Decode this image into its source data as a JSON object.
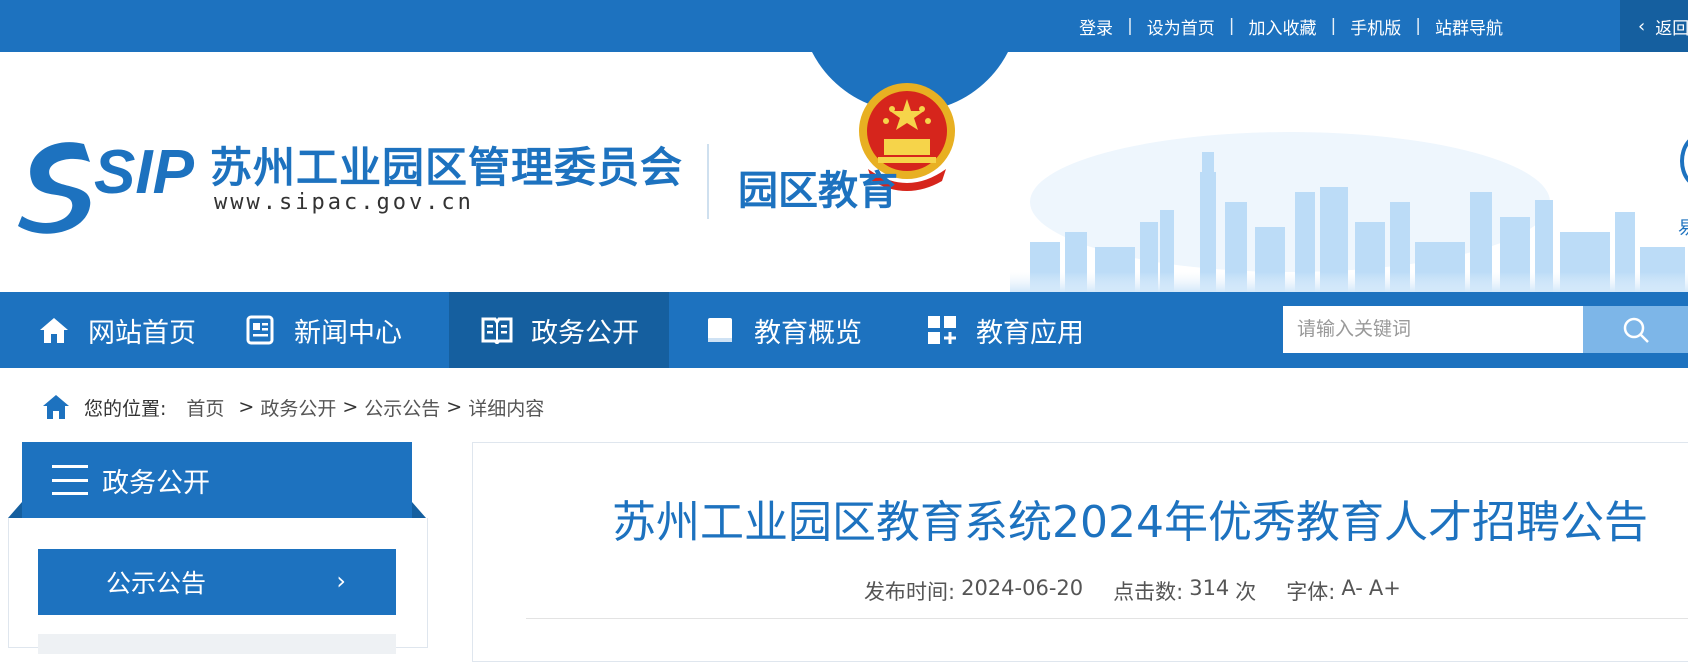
{
  "topbar": {
    "links": [
      "登录",
      "设为首页",
      "加入收藏",
      "手机版",
      "站群导航"
    ],
    "separator": "|",
    "back_label": "返回"
  },
  "header": {
    "logo_text": "SIP",
    "org_name": "苏州工业园区管理委员会",
    "org_url": "www.sipac.gov.cn",
    "site_name": "园区教育",
    "right_edge_char": "易"
  },
  "nav": {
    "items": [
      {
        "label": "网站首页",
        "icon": "home-icon"
      },
      {
        "label": "新闻中心",
        "icon": "news-icon"
      },
      {
        "label": "政务公开",
        "icon": "book-icon"
      },
      {
        "label": "教育概览",
        "icon": "folder-icon"
      },
      {
        "label": "教育应用",
        "icon": "apps-icon"
      }
    ],
    "active_index": 2,
    "search_placeholder": "请输入关键词"
  },
  "breadcrumb": {
    "label": "您的位置:",
    "items": [
      "首页",
      "政务公开",
      "公示公告",
      "详细内容"
    ],
    "separator": ">"
  },
  "sidebar": {
    "title": "政务公开",
    "items": [
      {
        "label": "公示公告"
      }
    ]
  },
  "article": {
    "title": "苏州工业园区教育系统2024年优秀教育人才招聘公告",
    "publish_label": "发布时间:",
    "publish_date": "2024-06-20",
    "clicks_label": "点击数:",
    "clicks": "314",
    "clicks_unit": "次",
    "font_label": "字体:",
    "font_minus": "A-",
    "font_plus": "A+"
  },
  "colors": {
    "primary": "#1d72bf",
    "primary_dark": "#155f9f",
    "search_button": "#7db6e8"
  }
}
